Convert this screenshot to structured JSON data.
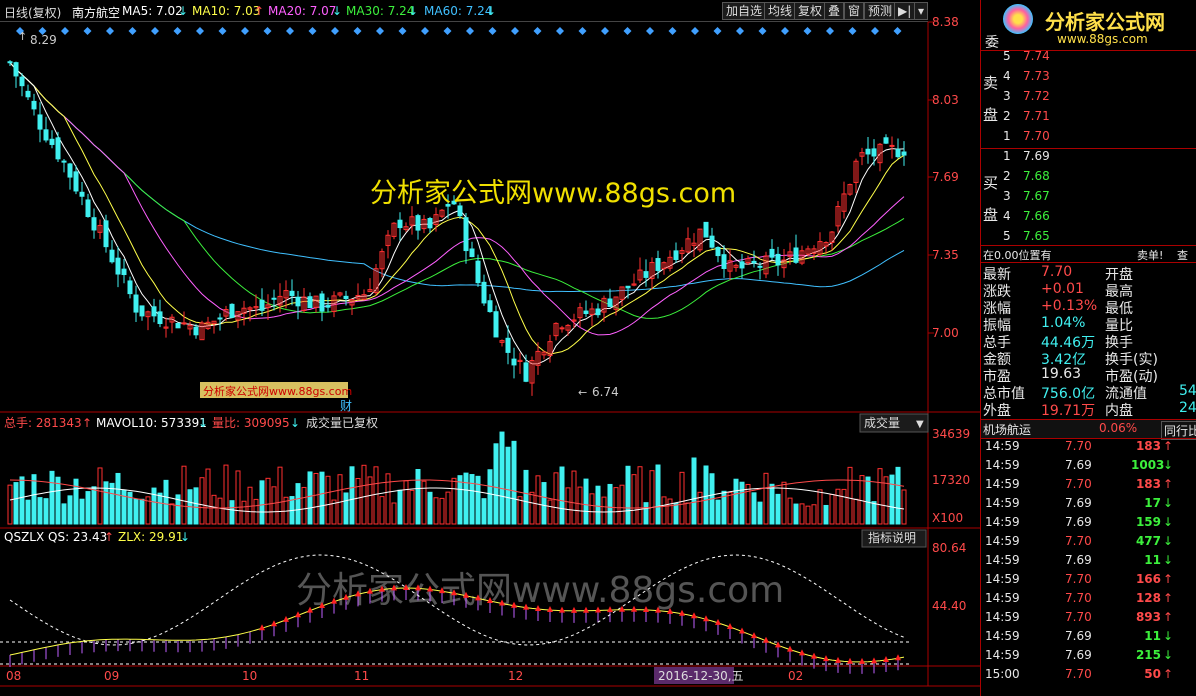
{
  "header": {
    "mode": "日线(复权)",
    "stock": "南方航空",
    "ma5": "MA5: 7.02",
    "ma10": "MA10: 7.03",
    "ma20": "MA20: 7.07",
    "ma30": "MA30: 7.24",
    "ma60": "MA60: 7.24",
    "ma5_dir": "↓",
    "ma10_dir": "↑",
    "ma20_dir": "↓",
    "ma30_dir": "↓",
    "ma60_dir": "↓"
  },
  "toolbar": {
    "add": "加自选",
    "avg": "均线",
    "fq": "复权",
    "overlay": "叠",
    "window": "窗",
    "forecast": "预测",
    "play": "▶|",
    "menu": "▾"
  },
  "chart_data": {
    "type": "candlestick",
    "price_axis": [
      "8.38",
      "8.03",
      "7.69",
      "7.35",
      "7.00"
    ],
    "high_label": "8.29",
    "low_label": "6.74",
    "cai_marker": "财",
    "x_labels": [
      "08",
      "09",
      "10",
      "11",
      "12",
      "02"
    ],
    "cursor_date": "2016-12-30,五",
    "volume_axis": [
      "34639",
      "17320",
      "X100"
    ],
    "indicator_axis": [
      "80.64",
      "44.40"
    ],
    "volume_header": {
      "total": "总手: 281343",
      "total_dir": "↑",
      "mavol": "MAVOL10: 573391",
      "mavol_dir": "↓",
      "ratio": "量比: 309095",
      "ratio_dir": "↓",
      "note": "成交量已复权",
      "selector": "成交量"
    },
    "indicator_header": {
      "name": "QSZLX",
      "qs": "QS: 23.43",
      "qs_dir": "↑",
      "zlx": "ZLX: 29.91",
      "zlx_dir": "↓",
      "help": "指标说明"
    }
  },
  "watermarks": {
    "main": "分析家公式网www.88gs.com",
    "small": "分析家公式网www.88gs.com",
    "bottom": "分析家公式网www.88gs.com",
    "logo": "分析家公式网",
    "logo_url": "www.88gs.com"
  },
  "orderbook": {
    "wei": "委",
    "sell_label": [
      "卖",
      "盘"
    ],
    "buy_label": [
      "买",
      "盘"
    ],
    "sell": [
      [
        "5",
        "7.74"
      ],
      [
        "4",
        "7.73"
      ],
      [
        "3",
        "7.72"
      ],
      [
        "2",
        "7.71"
      ],
      [
        "1",
        "7.70"
      ]
    ],
    "buy": [
      [
        "1",
        "7.69"
      ],
      [
        "2",
        "7.68"
      ],
      [
        "3",
        "7.67"
      ],
      [
        "4",
        "7.66"
      ],
      [
        "5",
        "7.65"
      ]
    ]
  },
  "quote": {
    "position_label": "在0.00位置有",
    "sell_order": "卖单!",
    "more": "查",
    "rows": [
      [
        "最新",
        "7.70",
        "开盘",
        ""
      ],
      [
        "涨跌",
        "+0.01",
        "最高",
        ""
      ],
      [
        "涨幅",
        "+0.13%",
        "最低",
        ""
      ],
      [
        "振幅",
        "1.04%",
        "量比",
        ""
      ],
      [
        "总手",
        "44.46万",
        "换手",
        ""
      ],
      [
        "金额",
        "3.42亿",
        "换手(实)",
        ""
      ],
      [
        "市盈",
        "19.63",
        "市盈(动)",
        ""
      ],
      [
        "总市值",
        "756.0亿",
        "流通值",
        "54"
      ],
      [
        "外盘",
        "19.71万",
        "内盘",
        "24"
      ]
    ]
  },
  "sector": {
    "name": "机场航运",
    "pct": "0.06%",
    "tab": "同行比"
  },
  "ticks": [
    [
      "14:59",
      "7.70",
      "183",
      "↑",
      "r"
    ],
    [
      "14:59",
      "7.69",
      "1003",
      "↓",
      "g"
    ],
    [
      "14:59",
      "7.70",
      "183",
      "↑",
      "r"
    ],
    [
      "14:59",
      "7.69",
      "17",
      "↓",
      "g"
    ],
    [
      "14:59",
      "7.69",
      "159",
      "↓",
      "g"
    ],
    [
      "14:59",
      "7.70",
      "477",
      "↓",
      "g"
    ],
    [
      "14:59",
      "7.69",
      "11",
      "↓",
      "g"
    ],
    [
      "14:59",
      "7.70",
      "166",
      "↑",
      "r"
    ],
    [
      "14:59",
      "7.70",
      "128",
      "↑",
      "r"
    ],
    [
      "14:59",
      "7.70",
      "893",
      "↑",
      "r"
    ],
    [
      "14:59",
      "7.69",
      "11",
      "↓",
      "g"
    ],
    [
      "14:59",
      "7.69",
      "215",
      "↓",
      "g"
    ],
    [
      "15:00",
      "7.70",
      "50",
      "↑",
      "r"
    ]
  ]
}
